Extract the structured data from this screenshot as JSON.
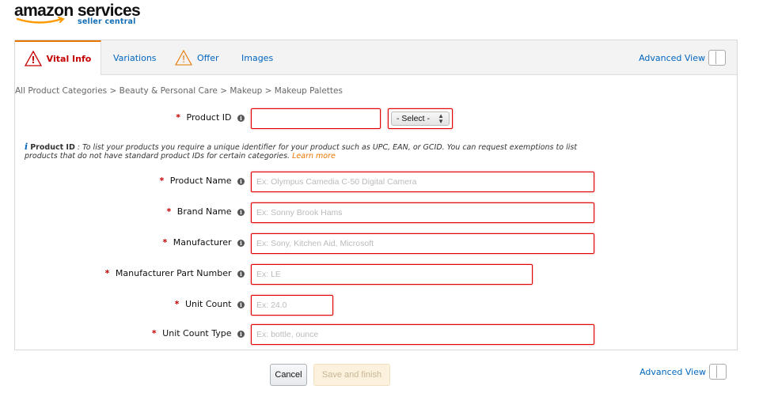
{
  "brand": {
    "wordmark_main": "amazon",
    "wordmark_services": "services",
    "subtitle": "seller central"
  },
  "tabs": [
    {
      "label": "Vital Info",
      "warning": true,
      "active": true
    },
    {
      "label": "Variations",
      "warning": false,
      "active": false
    },
    {
      "label": "Offer",
      "warning": true,
      "active": false
    },
    {
      "label": "Images",
      "warning": false,
      "active": false
    }
  ],
  "advanced_view_label": "Advanced View",
  "breadcrumb": "All Product Categories > Beauty & Personal Care > Makeup > Makeup Palettes",
  "product_id": {
    "label": "Product ID",
    "value": "",
    "select_value": "- Select -"
  },
  "help": {
    "icon": "i",
    "title": "Product ID",
    "text": " : To list your products you require a unique identifier for your product such as UPC, EAN, or GCID. You can request exemptions to list products that do not have standard product IDs for certain categories.",
    "link": "Learn more"
  },
  "fields": [
    {
      "label": "Product Name",
      "placeholder": "Ex: Olympus Camedia C-50 Digital Camera"
    },
    {
      "label": "Brand Name",
      "placeholder": "Ex: Sonny Brook Hams"
    },
    {
      "label": "Manufacturer",
      "placeholder": "Ex: Sony, Kitchen Aid, Microsoft"
    },
    {
      "label": "Manufacturer Part Number",
      "placeholder": "Ex: LE"
    },
    {
      "label": "Unit Count",
      "placeholder": "Ex: 24.0"
    },
    {
      "label": "Unit Count Type",
      "placeholder": "Ex: bottle, ounce"
    }
  ],
  "required_marker": "*",
  "info_glyph": "i",
  "buttons": {
    "cancel": "Cancel",
    "save": "Save and finish"
  },
  "colors": {
    "error": "#c40000",
    "link": "#0066c0",
    "accent": "#e77600"
  }
}
